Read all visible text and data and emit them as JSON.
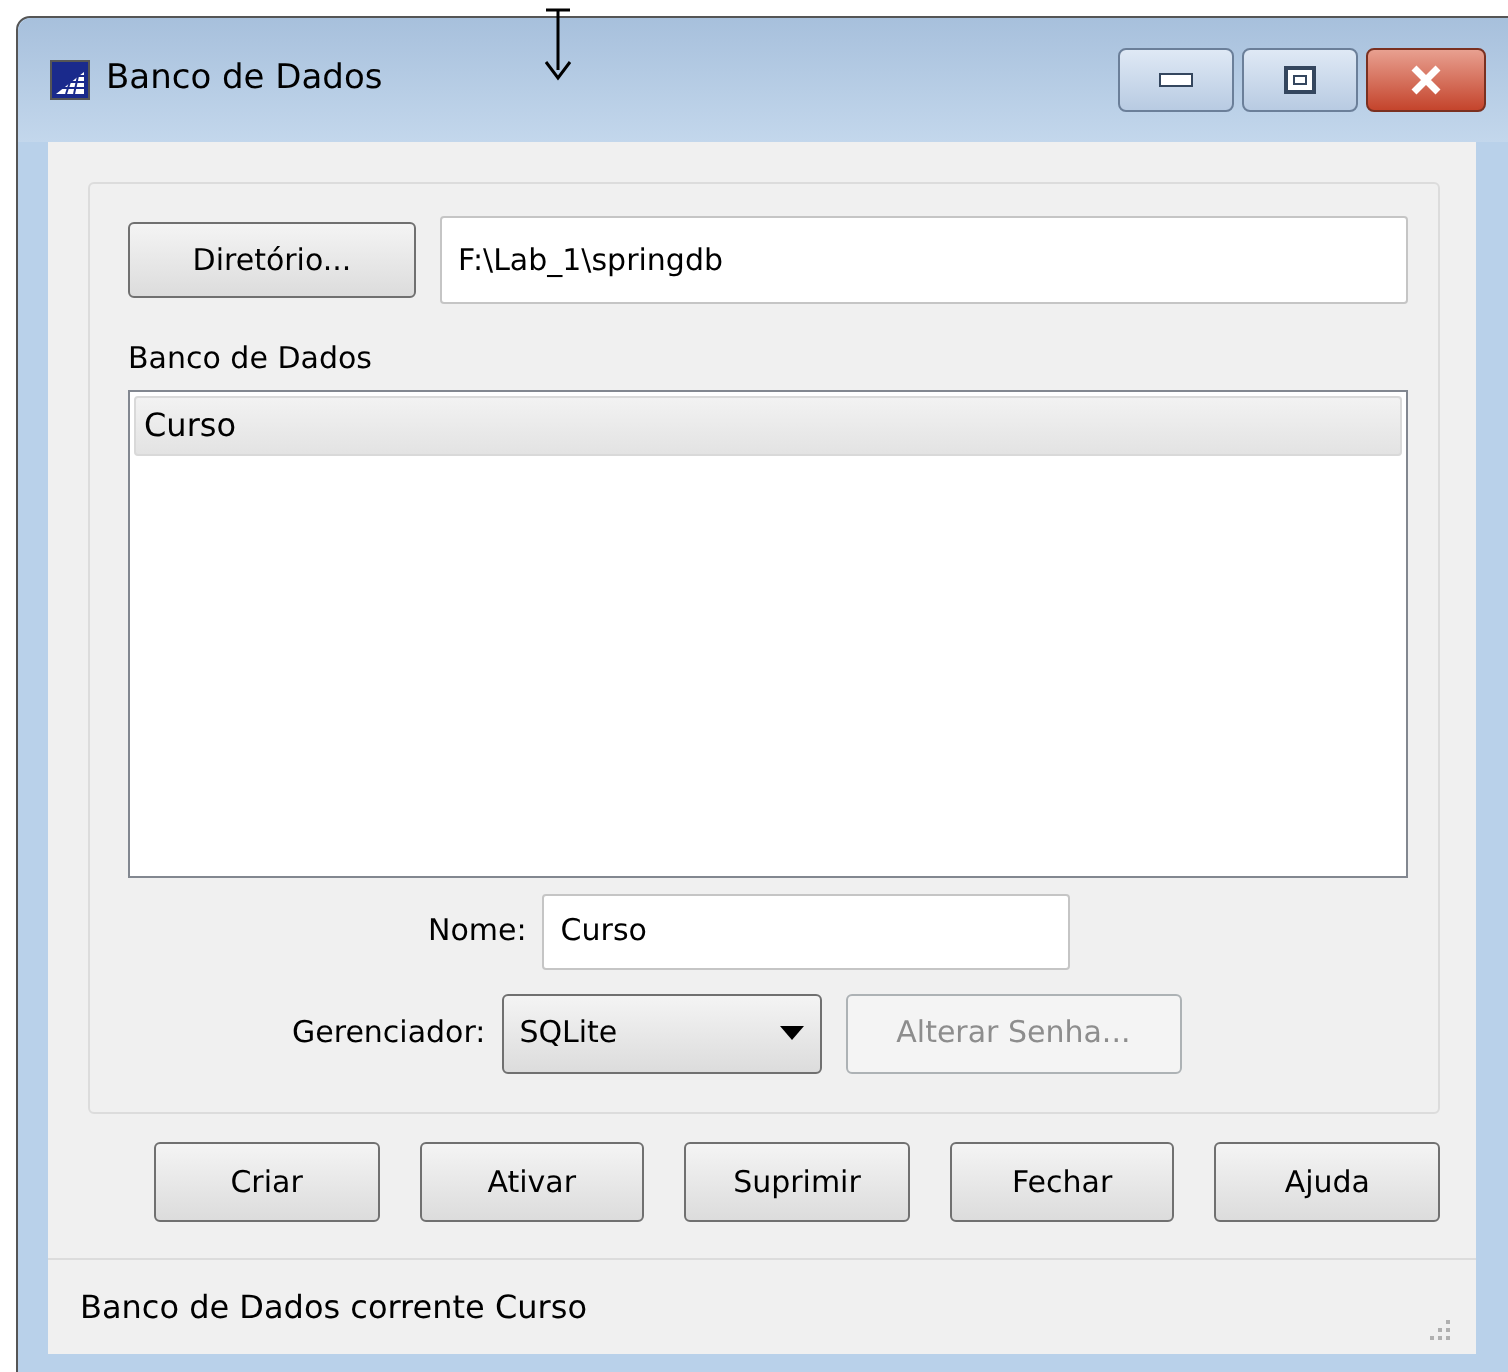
{
  "window": {
    "title": "Banco de Dados"
  },
  "directory": {
    "button": {
      "label": "Diretório..."
    },
    "value": "F:\\Lab_1\\springdb"
  },
  "database_list": {
    "label": "Banco de Dados",
    "items": [
      {
        "label": "Curso",
        "selected": true
      }
    ]
  },
  "name": {
    "label": "Nome:",
    "value": "Curso"
  },
  "manager": {
    "label": "Gerenciador:",
    "value": "SQLite",
    "change_password": {
      "label": "Alterar Senha...",
      "disabled": true
    }
  },
  "buttons": [
    {
      "label": "Criar",
      "disabled": false
    },
    {
      "label": "Ativar",
      "disabled": false
    },
    {
      "label": "Suprimir",
      "disabled": false
    },
    {
      "label": "Fechar",
      "disabled": false
    },
    {
      "label": "Ajuda",
      "disabled": false
    }
  ],
  "status_bar": "Banco de Dados corrente Curso"
}
